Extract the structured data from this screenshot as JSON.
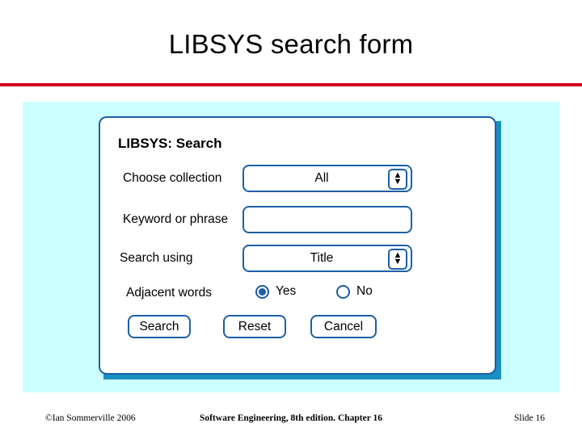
{
  "slide": {
    "title": "LIBSYS search form",
    "accent_color": "#d6001c",
    "panel_color": "#ccffff",
    "control_border_color": "#1d5fa8"
  },
  "form": {
    "heading": "LIBSYS: Search",
    "fields": [
      {
        "label": "Choose collection",
        "type": "dropdown",
        "value": "All",
        "stepper_up": "▲",
        "stepper_down": "▼"
      },
      {
        "label": "Keyword or phrase",
        "type": "text",
        "value": "",
        "placeholder": ""
      },
      {
        "label": "Search using",
        "type": "dropdown",
        "value": "Title",
        "stepper_up": "▲",
        "stepper_down": "▼"
      },
      {
        "label": "Adjacent words",
        "type": "radio-group",
        "options": [
          {
            "label": "Yes",
            "selected": true
          },
          {
            "label": "No",
            "selected": false
          }
        ]
      }
    ],
    "buttons": [
      {
        "label": "Search"
      },
      {
        "label": "Reset"
      },
      {
        "label": "Cancel"
      }
    ]
  },
  "footer": {
    "left": "©Ian Sommerville 2006",
    "center": "Software Engineering, 8th edition. Chapter 16",
    "right": "Slide  16"
  }
}
